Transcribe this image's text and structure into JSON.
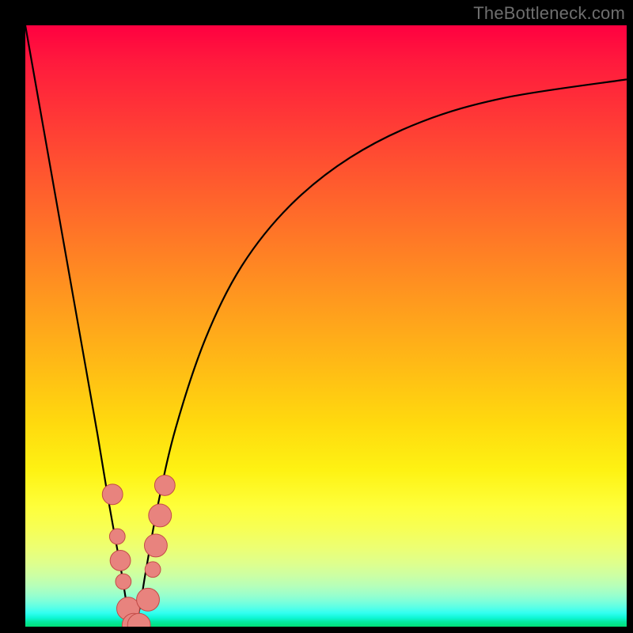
{
  "watermark": "TheBottleneck.com",
  "chart_data": {
    "type": "line",
    "title": "",
    "xlabel": "",
    "ylabel": "",
    "xlim": [
      0,
      100
    ],
    "ylim": [
      0,
      100
    ],
    "grid": false,
    "legend_position": "none",
    "curve_minimum_x": 18,
    "series": [
      {
        "name": "bottleneck-curve",
        "x": [
          0,
          3,
          6,
          9,
          12,
          14,
          16,
          17,
          18,
          19,
          20,
          22,
          25,
          30,
          36,
          44,
          54,
          66,
          80,
          100
        ],
        "y": [
          100,
          83,
          66,
          49,
          32,
          20,
          9,
          3,
          0,
          3,
          9,
          20,
          33,
          48,
          60,
          70,
          78,
          84,
          88,
          91
        ]
      }
    ],
    "markers": [
      {
        "x": 14.5,
        "y": 22,
        "r": 1.7
      },
      {
        "x": 15.3,
        "y": 15,
        "r": 1.3
      },
      {
        "x": 15.8,
        "y": 11,
        "r": 1.7
      },
      {
        "x": 16.3,
        "y": 7.5,
        "r": 1.3
      },
      {
        "x": 17.1,
        "y": 3.0,
        "r": 1.9
      },
      {
        "x": 18.0,
        "y": 0.3,
        "r": 1.9
      },
      {
        "x": 18.9,
        "y": 0.3,
        "r": 1.9
      },
      {
        "x": 20.4,
        "y": 4.5,
        "r": 1.9
      },
      {
        "x": 21.2,
        "y": 9.5,
        "r": 1.3
      },
      {
        "x": 21.7,
        "y": 13.5,
        "r": 1.9
      },
      {
        "x": 22.4,
        "y": 18.5,
        "r": 1.9
      },
      {
        "x": 23.2,
        "y": 23.5,
        "r": 1.7
      }
    ],
    "marker_color": "#e8837e",
    "marker_stroke": "#c34b47"
  }
}
